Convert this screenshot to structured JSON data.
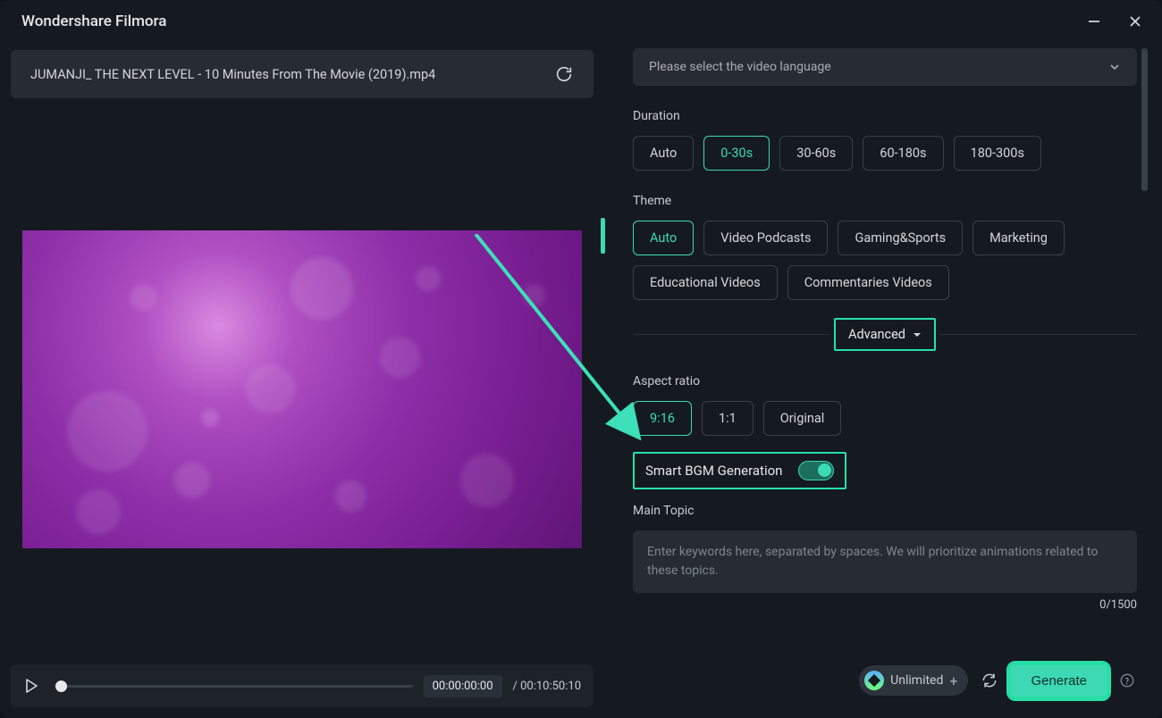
{
  "app_title": "Wondershare Filmora",
  "file_name": "JUMANJI_ THE NEXT LEVEL - 10 Minutes From The Movie (2019).mp4",
  "player": {
    "current_time": "00:00:00:00",
    "total_time": "/ 00:10:50:10"
  },
  "language_select": {
    "placeholder": "Please select the video language"
  },
  "duration": {
    "label": "Duration",
    "options": [
      "Auto",
      "0-30s",
      "30-60s",
      "60-180s",
      "180-300s"
    ],
    "selected_index": 1
  },
  "theme": {
    "label": "Theme",
    "options": [
      "Auto",
      "Video Podcasts",
      "Gaming&Sports",
      "Marketing",
      "Educational Videos",
      "Commentaries Videos"
    ],
    "selected_index": 0
  },
  "advanced_label": "Advanced",
  "aspect_ratio": {
    "label": "Aspect ratio",
    "options": [
      "9:16",
      "1:1",
      "Original"
    ],
    "selected_index": 0
  },
  "smart_bgm": {
    "label": "Smart BGM Generation",
    "enabled": true
  },
  "main_topic": {
    "label": "Main Topic",
    "placeholder": "Enter keywords here, separated by spaces. We will prioritize animations related to these topics.",
    "counter": "0/1500"
  },
  "footer": {
    "unlimited_label": "Unlimited",
    "generate_label": "Generate"
  }
}
